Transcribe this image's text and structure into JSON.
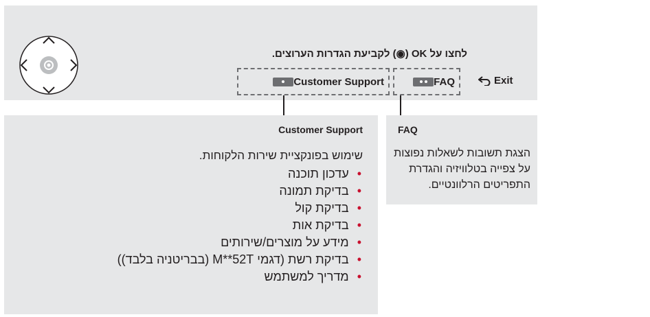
{
  "instruction_text": "לחצו על OK (◉) לקביעת הגדרות הערוצים.",
  "buttons": {
    "customer_support_label": "Customer Support",
    "faq_label": "FAQ",
    "exit_label": "Exit"
  },
  "customer_support_panel": {
    "title": "Customer Support",
    "intro": "שימוש בפונקציית שירות הלקוחות.",
    "items": [
      "עדכון תוכנה",
      "בדיקת תמונה",
      "בדיקת קול",
      "בדיקת אות",
      "מידע על מוצרים/שירותים",
      "בדיקת רשת (דגמי M**52T (בבריטניה בלבד))",
      "מדריך למשתמש"
    ]
  },
  "faq_panel": {
    "title": "FAQ",
    "description": "הצגת תשובות לשאלות נפוצות על צפייה בטלוויזיה והגדרת התפריטים הרלוונטיים."
  },
  "icons": [
    "dpad-icon",
    "ok-button-icon",
    "back-arrow-icon",
    "remote-red-button-icon",
    "remote-two-dot-button-icon"
  ],
  "colors": {
    "panel_bg": "#e6e7e8",
    "bullet": "#c8102e",
    "remote_button": "#6d6e71"
  }
}
